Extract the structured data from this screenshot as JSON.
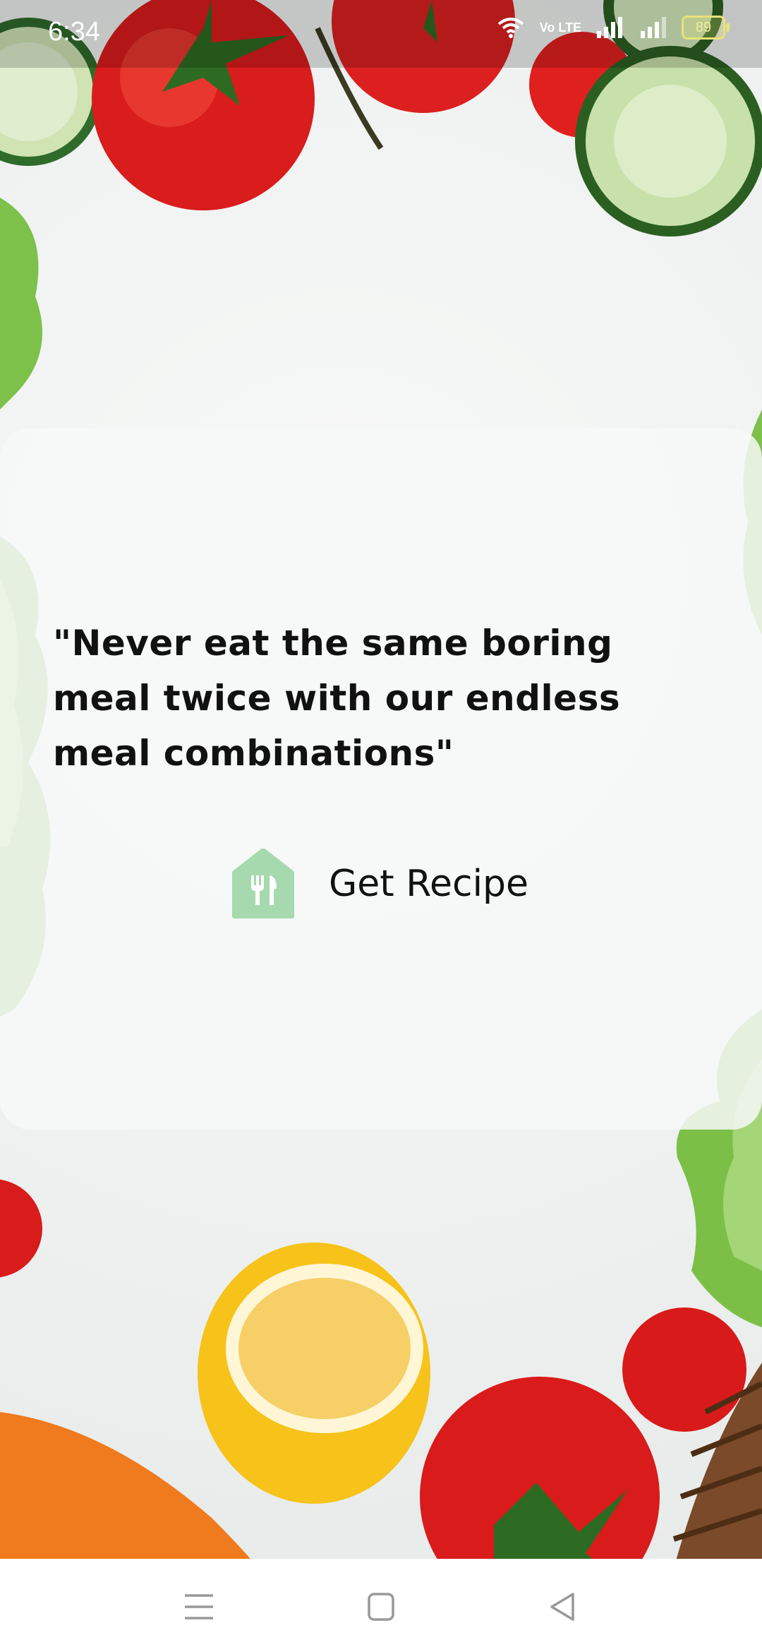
{
  "status_bar": {
    "time": "6:34",
    "network_badge": "Vo LTE",
    "battery": "89"
  },
  "card": {
    "quote": "\"Never eat the same boring meal twice with our endless meal combinations\"",
    "cta_label": "Get Recipe",
    "cta_icon": "restaurant-icon"
  },
  "navigation_bar": {
    "buttons": [
      "menu-icon",
      "home-icon",
      "back-icon"
    ]
  },
  "colors": {
    "accent_green": "#a6d9ad",
    "text": "#111111"
  }
}
